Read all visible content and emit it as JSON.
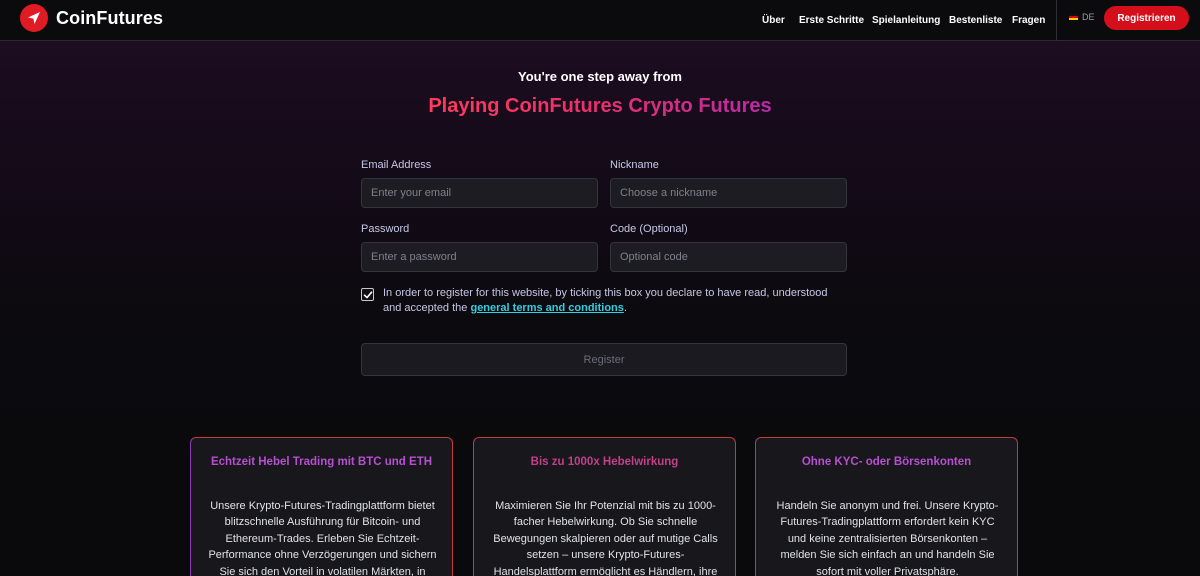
{
  "header": {
    "brand": "CoinFutures",
    "nav": [
      {
        "label": "Über"
      },
      {
        "label": "Erste Schritte"
      },
      {
        "label": "Spielanleitung"
      },
      {
        "label": "Bestenliste"
      },
      {
        "label": "Fragen"
      }
    ],
    "language": "DE",
    "register_label": "Registrieren"
  },
  "hero": {
    "subtitle": "You're one step away from",
    "title": "Playing CoinFutures Crypto Futures"
  },
  "form": {
    "email": {
      "label": "Email Address",
      "placeholder": "Enter your email",
      "value": ""
    },
    "nickname": {
      "label": "Nickname",
      "placeholder": "Choose a nickname",
      "value": ""
    },
    "password": {
      "label": "Password",
      "placeholder": "Enter a password",
      "value": ""
    },
    "code": {
      "label": "Code (Optional)",
      "placeholder": "Optional code",
      "value": ""
    },
    "terms_checked": true,
    "terms_text": "In order to register for this website, by ticking this box you declare to have read, understood and accepted the",
    "terms_link": "general terms and conditions",
    "terms_end": ".",
    "submit_label": "Register"
  },
  "features": [
    {
      "title": "Echtzeit Hebel Trading mit BTC und ETH",
      "title_color": "#b84fd0",
      "text": "Unsere Krypto-Futures-Tradingplattform bietet blitzschnelle Ausführung für Bitcoin- und Ethereum-Trades. Erleben Sie Echtzeit-Performance ohne Verzögerungen und sichern Sie sich den Vorteil in volatilen Märkten, in denen Geschwindigkeit"
    },
    {
      "title": "Bis zu 1000x Hebelwirkung",
      "title_color": "#c43f8a",
      "text": "Maximieren Sie Ihr Potenzial mit bis zu 1000-facher Hebelwirkung. Ob Sie schnelle Bewegungen skalpieren oder auf mutige Calls setzen – unsere Krypto-Futures-Handelsplattform ermöglicht es Händlern, ihre Positionen präzise und kontrolliert zu"
    },
    {
      "title": "Ohne KYC- oder Börsenkonten",
      "title_color": "#b84fd0",
      "text": "Handeln Sie anonym und frei. Unsere Krypto-Futures-Tradingplattform erfordert kein KYC und keine zentralisierten Börsenkonten – melden Sie sich einfach an und handeln Sie sofort mit voller Privatsphäre."
    }
  ],
  "colors": {
    "brand_red": "#d40f1b",
    "link_cyan": "#2fd0e0",
    "background": "#0a0a0c"
  }
}
